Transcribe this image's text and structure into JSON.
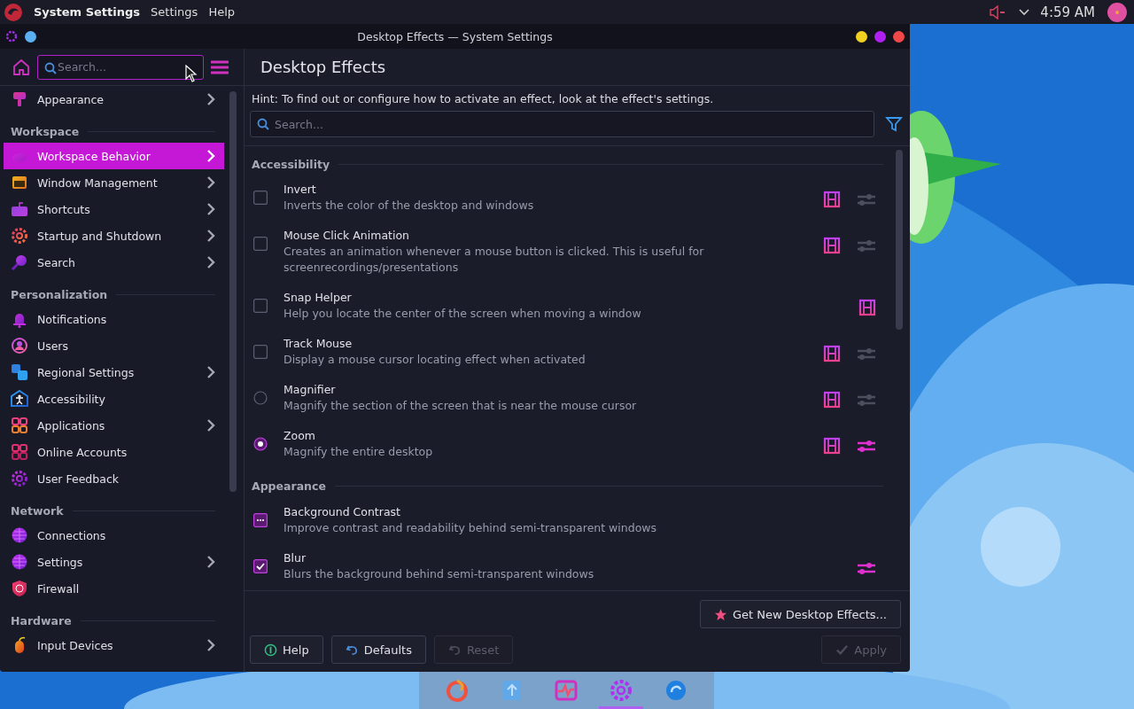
{
  "top_panel": {
    "app_name": "System Settings",
    "menus": [
      "Settings",
      "Help"
    ],
    "time": "4:59 AM"
  },
  "window": {
    "title": "Desktop Effects — System Settings"
  },
  "sidebar": {
    "search": {
      "placeholder": "Search..."
    },
    "sections": [
      {
        "items": [
          {
            "label": "Appearance",
            "selected": false,
            "submenu": true
          }
        ]
      },
      {
        "heading": "Workspace",
        "items": [
          {
            "label": "Workspace Behavior",
            "selected": true,
            "submenu": true
          },
          {
            "label": "Window Management",
            "selected": false,
            "submenu": true
          },
          {
            "label": "Shortcuts",
            "selected": false,
            "submenu": true
          },
          {
            "label": "Startup and Shutdown",
            "selected": false,
            "submenu": true
          },
          {
            "label": "Search",
            "selected": false,
            "submenu": true
          }
        ]
      },
      {
        "heading": "Personalization",
        "items": [
          {
            "label": "Notifications",
            "selected": false,
            "submenu": false
          },
          {
            "label": "Users",
            "selected": false,
            "submenu": false
          },
          {
            "label": "Regional Settings",
            "selected": false,
            "submenu": true
          },
          {
            "label": "Accessibility",
            "selected": false,
            "submenu": false
          },
          {
            "label": "Applications",
            "selected": false,
            "submenu": true
          },
          {
            "label": "Online Accounts",
            "selected": false,
            "submenu": false
          },
          {
            "label": "User Feedback",
            "selected": false,
            "submenu": false
          }
        ]
      },
      {
        "heading": "Network",
        "items": [
          {
            "label": "Connections",
            "selected": false,
            "submenu": false
          },
          {
            "label": "Settings",
            "selected": false,
            "submenu": true
          },
          {
            "label": "Firewall",
            "selected": false,
            "submenu": false
          }
        ]
      },
      {
        "heading": "Hardware",
        "items": [
          {
            "label": "Input Devices",
            "selected": false,
            "submenu": true
          }
        ]
      }
    ]
  },
  "page": {
    "title": "Desktop Effects",
    "hint": "Hint: To find out or configure how to activate an effect, look at the effect's settings.",
    "search": {
      "placeholder": "Search..."
    },
    "groups": [
      {
        "heading": "Accessibility",
        "effects": [
          {
            "kind": "checkbox",
            "name": "Invert",
            "description": "Inverts the color of the desktop and windows",
            "checked": false,
            "partial": false,
            "video": true,
            "configure": true,
            "configure_enabled": false
          },
          {
            "kind": "checkbox",
            "name": "Mouse Click Animation",
            "description": "Creates an animation whenever a mouse button is clicked. This is useful for screenrecordings/presentations",
            "checked": false,
            "partial": false,
            "video": true,
            "configure": true,
            "configure_enabled": false
          },
          {
            "kind": "checkbox",
            "name": "Snap Helper",
            "description": "Help you locate the center of the screen when moving a window",
            "checked": false,
            "partial": false,
            "video": true,
            "configure": false
          },
          {
            "kind": "checkbox",
            "name": "Track Mouse",
            "description": "Display a mouse cursor locating effect when activated",
            "checked": false,
            "partial": false,
            "video": true,
            "configure": true,
            "configure_enabled": false
          },
          {
            "kind": "radio",
            "name": "Magnifier",
            "description": "Magnify the section of the screen that is near the mouse cursor",
            "selected": false,
            "video": true,
            "configure": true,
            "configure_enabled": false
          },
          {
            "kind": "radio",
            "name": "Zoom",
            "description": "Magnify the entire desktop",
            "selected": true,
            "video": true,
            "configure": true,
            "configure_enabled": true
          }
        ]
      },
      {
        "heading": "Appearance",
        "effects": [
          {
            "kind": "checkbox",
            "name": "Background Contrast",
            "description": "Improve contrast and readability behind semi-transparent windows",
            "checked": false,
            "partial": true,
            "video": false,
            "configure": false
          },
          {
            "kind": "checkbox",
            "name": "Blur",
            "description": "Blurs the background behind semi-transparent windows",
            "checked": true,
            "partial": false,
            "video": false,
            "configure": true,
            "configure_enabled": true
          }
        ]
      }
    ],
    "get_new_button": "Get New Desktop Effects...",
    "buttons": [
      {
        "kind": "help",
        "label": "Help",
        "disabled": false
      },
      {
        "kind": "defaults",
        "label": "Defaults",
        "disabled": false
      },
      {
        "kind": "reset",
        "label": "Reset",
        "disabled": true
      },
      {
        "kind": "apply",
        "label": "Apply",
        "disabled": true
      }
    ]
  }
}
